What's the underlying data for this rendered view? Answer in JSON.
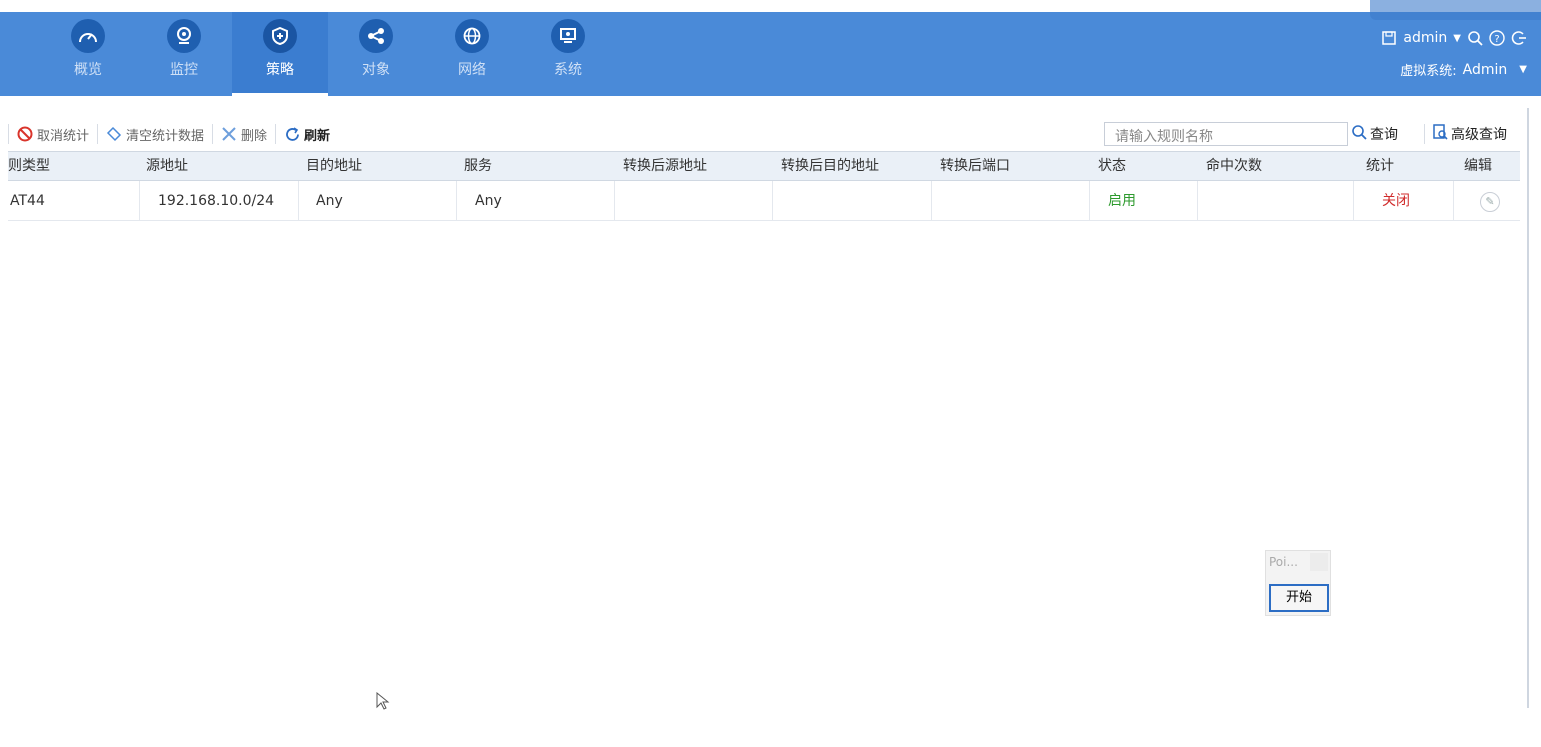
{
  "nav": {
    "items": [
      {
        "label": "概览",
        "icon": "speedometer-icon"
      },
      {
        "label": "监控",
        "icon": "webcam-icon"
      },
      {
        "label": "策略",
        "icon": "shield-icon"
      },
      {
        "label": "对象",
        "icon": "share-icon"
      },
      {
        "label": "网络",
        "icon": "globe-icon"
      },
      {
        "label": "系统",
        "icon": "monitor-icon"
      }
    ],
    "active": "策略"
  },
  "header": {
    "user": "admin",
    "virtual_system_label": "虚拟系统:",
    "virtual_system_value": "Admin"
  },
  "toolbar": {
    "cancel_stats": "取消统计",
    "clear_stats": "清空统计数据",
    "delete": "删除",
    "refresh": "刷新"
  },
  "search": {
    "placeholder": "请输入规则名称",
    "query": "查询",
    "advanced": "高级查询"
  },
  "table": {
    "headers": [
      "则类型",
      "源地址",
      "目的地址",
      "服务",
      "转换后源地址",
      "转换后目的地址",
      "转换后端口",
      "状态",
      "命中次数",
      "统计",
      "编辑"
    ],
    "rows": [
      {
        "type": "AT44",
        "src": "192.168.10.0/24",
        "dst": "Any",
        "service": "Any",
        "nat_src": "",
        "nat_dst": "",
        "nat_port": "",
        "status": "启用",
        "hits": "",
        "stats": "关闭"
      }
    ]
  },
  "mini_dialog": {
    "title": "Poi...",
    "start": "开始"
  },
  "colors": {
    "topbar": "#4a8ad8",
    "enabled": "#2e9a2e",
    "closed": "#d02b2b"
  }
}
